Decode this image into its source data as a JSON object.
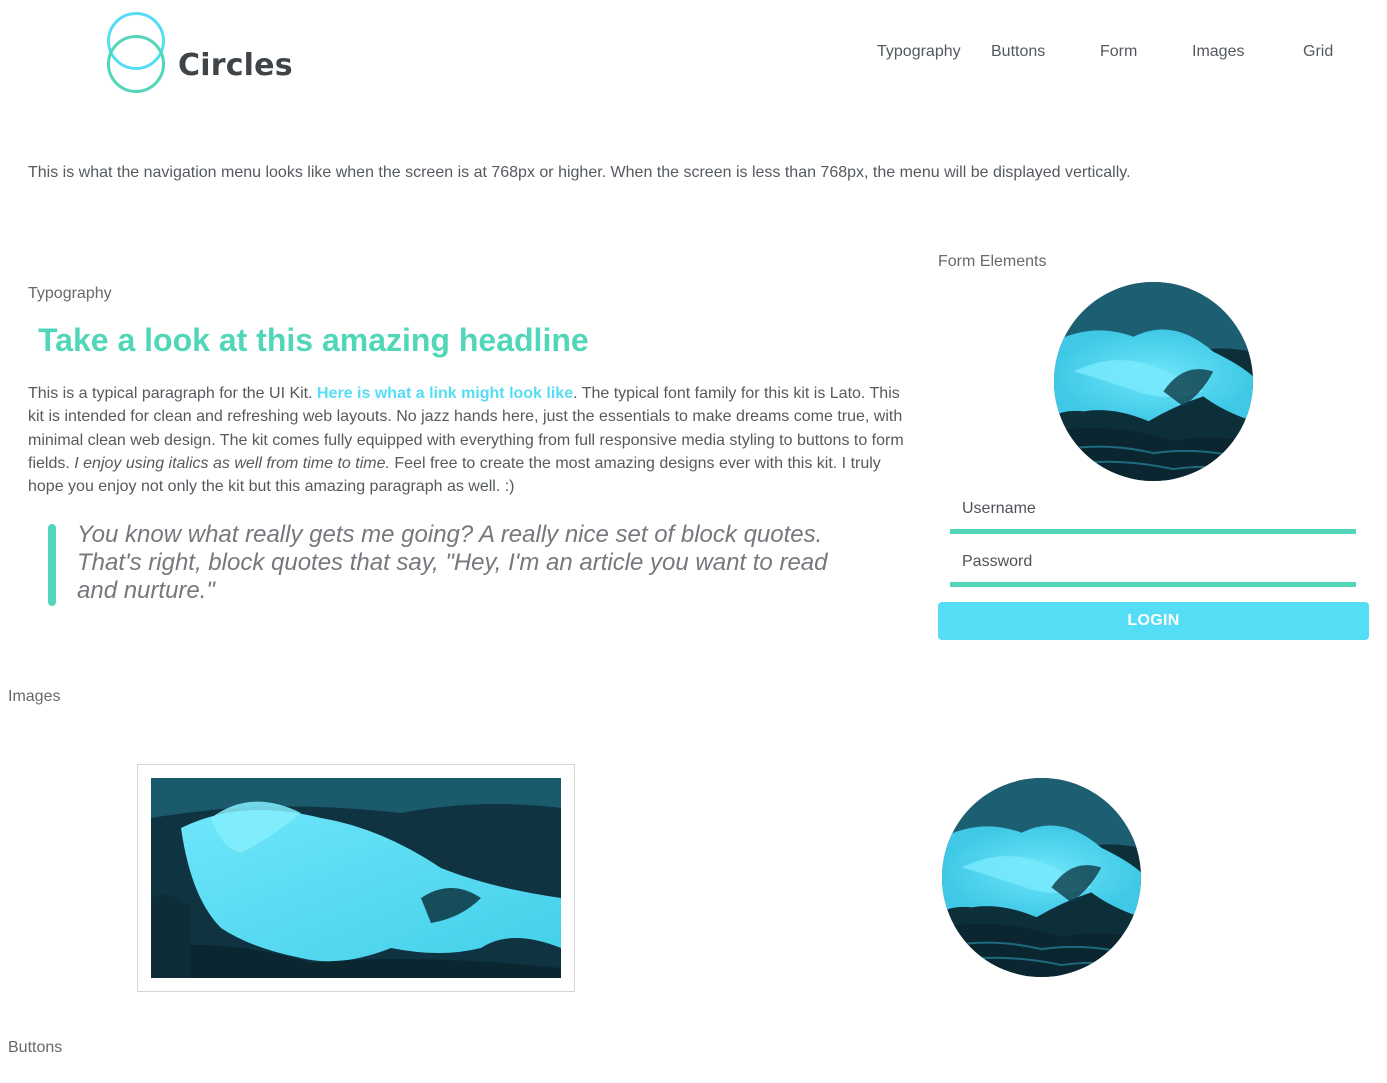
{
  "brand": {
    "name": "Circles",
    "ring_top_color": "#55ddf5",
    "ring_bottom_color": "#52d6b9"
  },
  "nav": {
    "items": [
      "Typography",
      "Buttons",
      "Form",
      "Images",
      "Grid"
    ]
  },
  "nav_note": "This is what the navigation menu looks like when the screen is at 768px or higher. When the screen is less than 768px, the menu will be displayed vertically.",
  "typography": {
    "section_label": "Typography",
    "headline": "Take a look at this amazing headline",
    "paragraph": {
      "part1": "This is a typical paragraph for the UI Kit. ",
      "link": "Here is what a link might look like",
      "part2": ". The typical font family for this kit is Lato. This kit is intended for clean and refreshing web layouts. No jazz hands here, just the essentials to make dreams come true, with minimal clean web design. The kit comes fully equipped with everything from full responsive media styling to buttons to form fields. ",
      "italic": "I enjoy using italics as well from time to time.",
      "part3": " Feel free to create the most amazing designs ever with this kit. I truly hope you enjoy not only the kit but this amazing paragraph as well. :)"
    },
    "blockquote": "You know what really gets me going? A really nice set of block quotes. That's right, block quotes that say, \"Hey, I'm an article you want to read and nurture.\""
  },
  "form": {
    "section_label": "Form Elements",
    "username_placeholder": "Username",
    "password_placeholder": "Password",
    "login_label": "LOGIN"
  },
  "images": {
    "section_label": "Images"
  },
  "buttons": {
    "section_label": "Buttons"
  },
  "colors": {
    "accent_teal": "#52d6b9",
    "accent_cyan": "#55ddf5",
    "body_text": "#555a5f"
  },
  "icons": [
    "circles-logo-icon"
  ]
}
